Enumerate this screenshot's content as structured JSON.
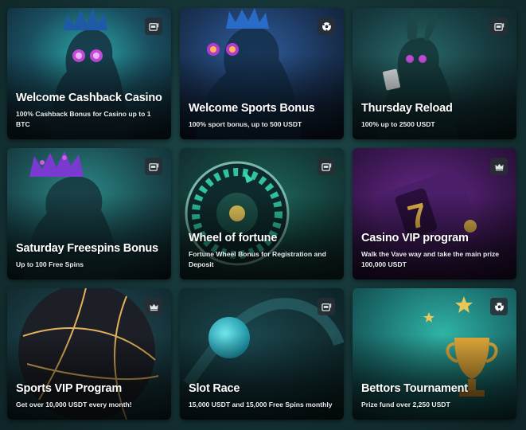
{
  "promotions": [
    {
      "title": "Welcome Cashback Casino",
      "desc": "100% Cashback Bonus for Casino up to 1 BTC",
      "badge": "slot-machine-icon"
    },
    {
      "title": "Welcome Sports Bonus",
      "desc": "100% sport bonus, up to 500 USDT",
      "badge": "soccer-ball-icon"
    },
    {
      "title": "Thursday Reload",
      "desc": "100% up to 2500 USDT",
      "badge": "slot-machine-icon"
    },
    {
      "title": "Saturday Freespins Bonus",
      "desc": "Up to 100 Free Spins",
      "badge": "slot-machine-icon"
    },
    {
      "title": "Wheel of fortune",
      "desc": "Fortune Wheel Bonus for Registration and Deposit",
      "badge": "slot-machine-icon"
    },
    {
      "title": "Casino VIP program",
      "desc": "Walk the Vave way and take the main prize",
      "desc2": "100,000 USDT",
      "badge": "crown-icon"
    },
    {
      "title": "Sports VIP Program",
      "desc": "Get over 10,000 USDT every month!",
      "badge": "crown-icon"
    },
    {
      "title": "Slot Race",
      "desc": "15,000 USDT and 15,000 Free Spins monthly",
      "badge": "slot-machine-icon"
    },
    {
      "title": "Bettors Tournament",
      "desc": "Prize fund over 2,250 USDT",
      "badge": "soccer-ball-icon"
    }
  ]
}
